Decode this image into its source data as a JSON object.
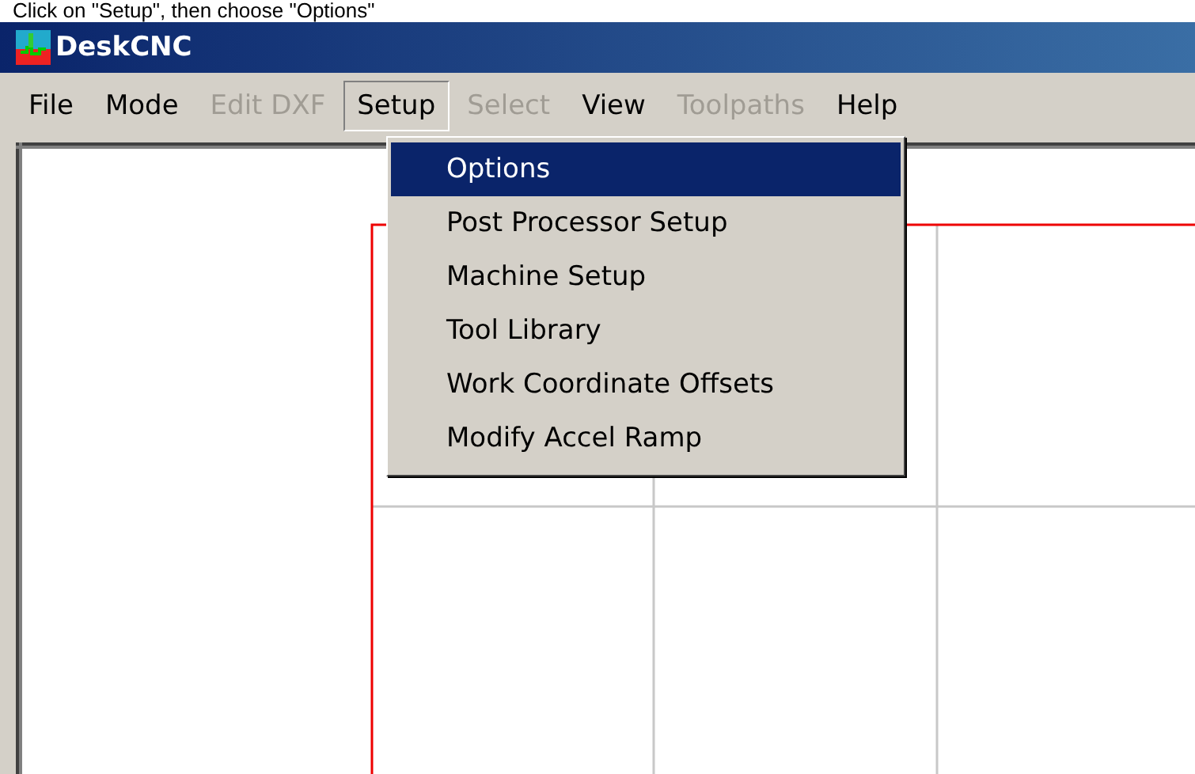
{
  "caption": "Click on \"Setup\", then choose \"Options\"",
  "window": {
    "title": "DeskCNC"
  },
  "menu_bar": [
    {
      "label": "File",
      "disabled": false,
      "selected": false
    },
    {
      "label": "Mode",
      "disabled": false,
      "selected": false
    },
    {
      "label": "Edit DXF",
      "disabled": true,
      "selected": false
    },
    {
      "label": "Setup",
      "disabled": false,
      "selected": true
    },
    {
      "label": "Select",
      "disabled": true,
      "selected": false
    },
    {
      "label": "View",
      "disabled": false,
      "selected": false
    },
    {
      "label": "Toolpaths",
      "disabled": true,
      "selected": false
    },
    {
      "label": "Help",
      "disabled": false,
      "selected": false
    }
  ],
  "dropdown": [
    {
      "label": "Options",
      "selected": true
    },
    {
      "label": "Post Processor Setup",
      "selected": false
    },
    {
      "label": "Machine Setup",
      "selected": false
    },
    {
      "label": "Tool Library",
      "selected": false
    },
    {
      "label": "Work Coordinate Offsets",
      "selected": false
    },
    {
      "label": "Modify Accel Ramp",
      "selected": false
    }
  ]
}
